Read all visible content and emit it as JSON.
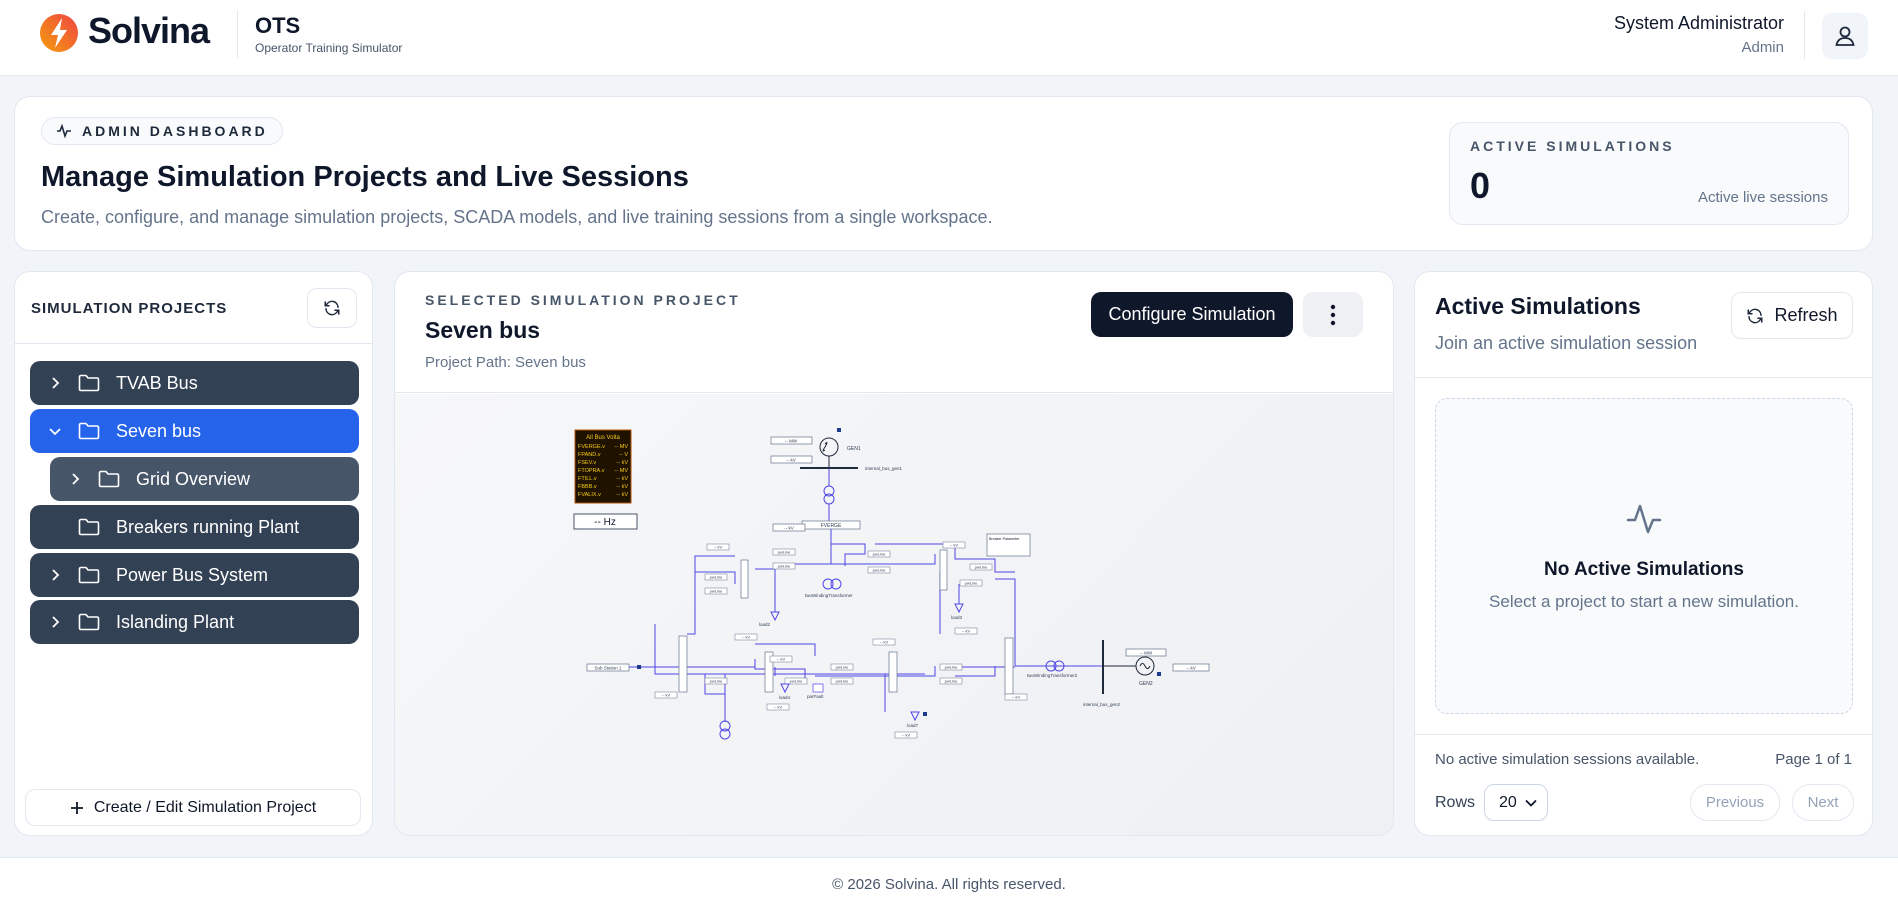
{
  "header": {
    "brand": "Solvina",
    "app_name": "OTS",
    "app_subtitle": "Operator Training Simulator",
    "user_name": "System Administrator",
    "user_role": "Admin",
    "logo_colors": [
      "#f59e0b",
      "#ef4444"
    ]
  },
  "hero": {
    "badge": "ADMIN DASHBOARD",
    "title": "Manage Simulation Projects and Live Sessions",
    "description": "Create, configure, and manage simulation projects, SCADA models, and live training sessions from a single workspace.",
    "stat_label": "ACTIVE SIMULATIONS",
    "stat_value": "0",
    "stat_note": "Active live sessions"
  },
  "projects": {
    "title": "SIMULATION PROJECTS",
    "items": [
      {
        "label": "TVAB Bus",
        "expanded": false,
        "has_children": true
      },
      {
        "label": "Seven bus",
        "expanded": true,
        "has_children": true,
        "selected": true
      },
      {
        "label": "Grid Overview",
        "expanded": false,
        "has_children": true,
        "child": true
      },
      {
        "label": "Breakers running Plant",
        "expanded": false,
        "has_children": false
      },
      {
        "label": "Power Bus System",
        "expanded": false,
        "has_children": true
      },
      {
        "label": "Islanding Plant",
        "expanded": false,
        "has_children": true
      }
    ],
    "create_label": "Create / Edit Simulation Project"
  },
  "selected": {
    "kicker": "SELECTED SIMULATION PROJECT",
    "title": "Seven bus",
    "path": "Project Path: Seven bus",
    "configure_label": "Configure Simulation"
  },
  "diagram": {
    "volt_title": "All Bus Volta",
    "volt_rows": [
      {
        "name": "FVERGE.v",
        "val": "-- MV"
      },
      {
        "name": "FPAND.v",
        "val": "-- V"
      },
      {
        "name": "FSEV.v",
        "val": "-- kV"
      },
      {
        "name": "FTOPRA.v",
        "val": "-- MV"
      },
      {
        "name": "FTILL.v",
        "val": "-- kV"
      },
      {
        "name": "FBBB.v",
        "val": "-- kV"
      },
      {
        "name": "FVALIX.v",
        "val": "-- kV"
      }
    ],
    "freq": "-- Hz",
    "labels": {
      "gen1": "GEN1",
      "gen2": "GEN2",
      "bus_gen1": "internal_bus_gen1",
      "bus_gen2": "internal_bus_gen2",
      "verge": "FVERGE",
      "transformer": "twoWindingTransformer",
      "transformer2": "twoWindingTransformer2",
      "sub_station": "Sub Station 1",
      "load2": "load2",
      "load3": "load3",
      "load4": "load4",
      "load7": "load7",
      "parfault": "parFault",
      "breaker_prefix": "pwLine",
      "kv": "-- kV",
      "mw": "-- MW",
      "legend_title": "Breaker Parameter"
    },
    "colors": {
      "line": "#4f46e5",
      "node": "#1e40af",
      "panel_bg": "#1f1300",
      "panel_border": "#b45309",
      "panel_text": "#facc15"
    }
  },
  "active": {
    "title": "Active Simulations",
    "subtitle": "Join an active simulation session",
    "refresh_label": "Refresh",
    "empty_title": "No Active Simulations",
    "empty_sub": "Select a project to start a new simulation.",
    "status": "No active simulation sessions available.",
    "page": "Page 1 of 1",
    "rows_label": "Rows",
    "rows_value": "20",
    "prev_label": "Previous",
    "next_label": "Next"
  },
  "footer": {
    "copyright": "© 2026 Solvina. All rights reserved."
  }
}
